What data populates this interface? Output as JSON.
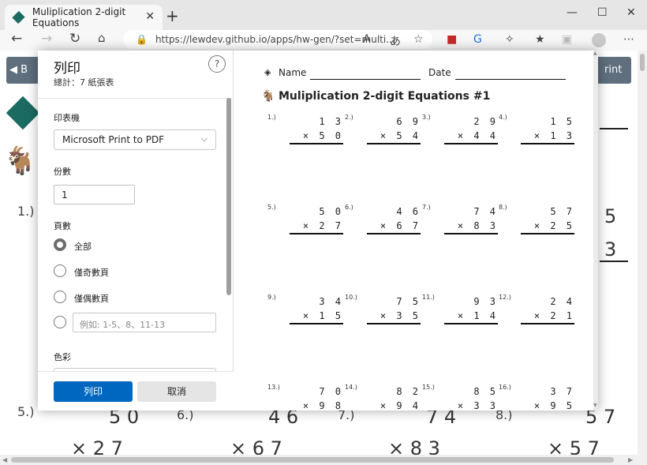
{
  "browser": {
    "tab_title": "Muliplication 2-digit Equations",
    "url": "https://lewdev.github.io/apps/hw-gen/?set=multi...",
    "window_controls": [
      "—",
      "☐",
      "✕"
    ]
  },
  "background_page": {
    "back_button": "B",
    "print_button": "rint",
    "numbers": {
      "p1": "1.)",
      "p5": "5.)",
      "p6": "6.)",
      "p7": "7.)",
      "p8": "8.)",
      "r1": "5",
      "r2": "3",
      "b5a": "5 0",
      "b6a": "4 6",
      "b7a": "7 4",
      "b8a": "5 7",
      "b5b": "× 2 7",
      "b6b": "× 6 7",
      "b7b": "× 8 3",
      "b8b": "× 5 7"
    }
  },
  "print_dialog": {
    "title": "列印",
    "subtitle": "總計：7 紙張表",
    "help": "?",
    "printer_label": "印表機",
    "printer_value": "Microsoft Print to PDF",
    "copies_label": "份數",
    "copies_value": "1",
    "pages_label": "頁數",
    "page_options": [
      "全部",
      "僅奇數頁",
      "僅偶數頁"
    ],
    "range_placeholder": "例如: 1-5、8、11-13",
    "color_label": "色彩",
    "print_button": "列印",
    "cancel_button": "取消"
  },
  "worksheet": {
    "name_label": "Name",
    "date_label": "Date",
    "title": "Muliplication 2-digit Equations #1",
    "problems": [
      {
        "n": "1.)",
        "a": "1 3",
        "b": "× 5 0"
      },
      {
        "n": "2.)",
        "a": "6 9",
        "b": "× 5 4"
      },
      {
        "n": "3.)",
        "a": "2 9",
        "b": "× 4 4"
      },
      {
        "n": "4.)",
        "a": "1 5",
        "b": "× 1 3"
      },
      {
        "n": "5.)",
        "a": "5 0",
        "b": "× 2 7"
      },
      {
        "n": "6.)",
        "a": "4 6",
        "b": "× 6 7"
      },
      {
        "n": "7.)",
        "a": "7 4",
        "b": "× 8 3"
      },
      {
        "n": "8.)",
        "a": "5 7",
        "b": "× 2 5"
      },
      {
        "n": "9.)",
        "a": "3 4",
        "b": "× 1 5"
      },
      {
        "n": "10.)",
        "a": "7 5",
        "b": "× 3 5"
      },
      {
        "n": "11.)",
        "a": "9 3",
        "b": "× 1 4"
      },
      {
        "n": "12.)",
        "a": "2 4",
        "b": "× 2 1"
      },
      {
        "n": "13.)",
        "a": "7 0",
        "b": "× 9 8"
      },
      {
        "n": "14.)",
        "a": "8 2",
        "b": "× 9 4"
      },
      {
        "n": "15.)",
        "a": "8 5",
        "b": "× 3 3"
      },
      {
        "n": "16.)",
        "a": "3 7",
        "b": "× 9 5"
      }
    ]
  }
}
